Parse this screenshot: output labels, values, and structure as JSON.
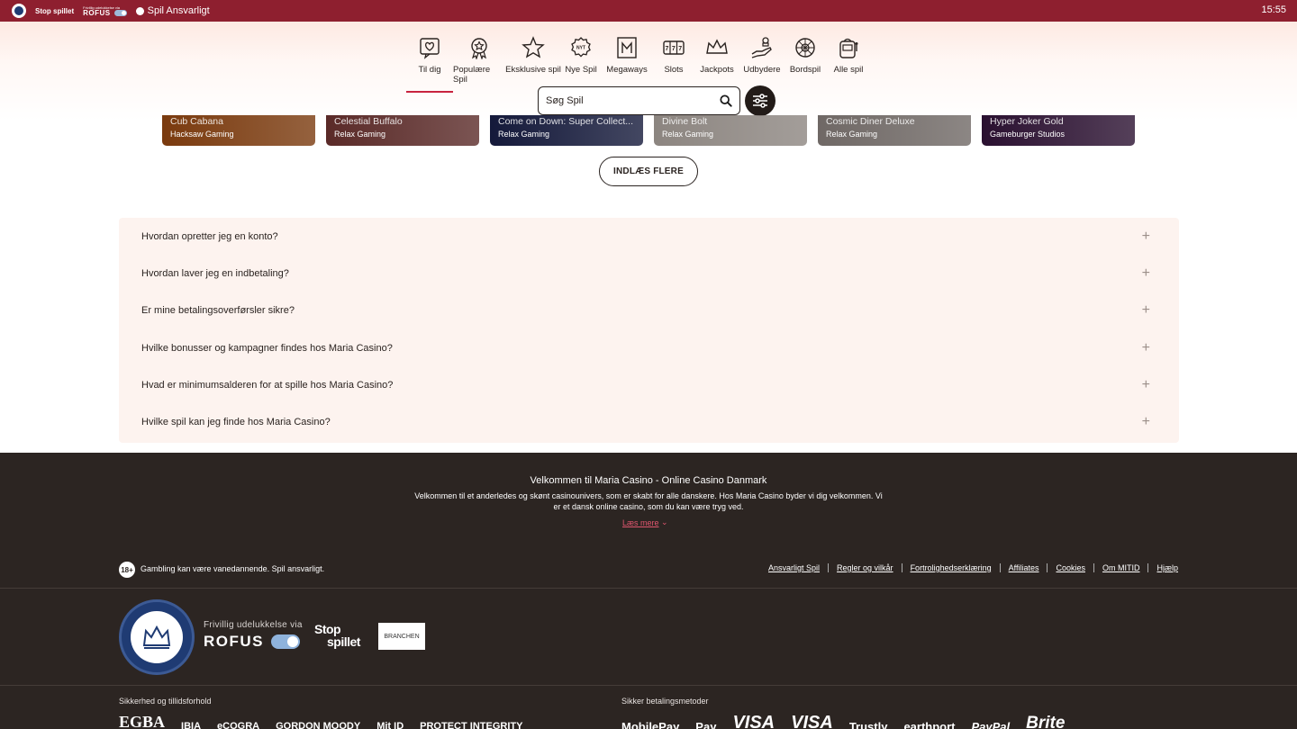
{
  "topbar": {
    "stop_label": "Stop spillet",
    "rofus_small": "Frivillig udelukkelse via",
    "rofus_label": "ROFUS",
    "responsible_label": "Spil Ansvarligt",
    "time": "15:55"
  },
  "categories": [
    {
      "label": "Til dig",
      "icon": "heart-chat-icon",
      "active": true
    },
    {
      "label": "Populære Spil",
      "icon": "award-icon",
      "active": false
    },
    {
      "label": "Eksklusive spil",
      "icon": "star-icon",
      "active": false
    },
    {
      "label": "Nye Spil",
      "icon": "new-badge-icon",
      "active": false
    },
    {
      "label": "Megaways",
      "icon": "megaways-icon",
      "active": false
    },
    {
      "label": "Slots",
      "icon": "slot-reels-icon",
      "active": false
    },
    {
      "label": "Jackpots",
      "icon": "crown-icon",
      "active": false
    },
    {
      "label": "Udbydere",
      "icon": "hand-chips-icon",
      "active": false
    },
    {
      "label": "Bordspil",
      "icon": "roulette-icon",
      "active": false
    },
    {
      "label": "Alle spil",
      "icon": "slot-machine-icon",
      "active": false
    }
  ],
  "search": {
    "placeholder": "Søg Spil"
  },
  "games": [
    {
      "title": "Cub Cabana",
      "provider": "Hacksaw Gaming",
      "color": "#7a3a0e"
    },
    {
      "title": "Celestial Buffalo",
      "provider": "Relax Gaming",
      "color": "#5a2a28"
    },
    {
      "title": "Come on Down: Super Collect...",
      "provider": "Relax Gaming",
      "color": "#14193a"
    },
    {
      "title": "Divine Bolt",
      "provider": "Relax Gaming",
      "color": "#8c8580"
    },
    {
      "title": "Cosmic Diner Deluxe",
      "provider": "Relax Gaming",
      "color": "#6f6865"
    },
    {
      "title": "Hyper Joker Gold",
      "provider": "Gameburger Studios",
      "color": "#2a1030"
    }
  ],
  "load_more": "INDLÆS FLERE",
  "faq": [
    "Hvordan opretter jeg en konto?",
    "Hvordan laver jeg en indbetaling?",
    "Er mine betalingsoverførsler sikre?",
    "Hvilke bonusser og kampagner findes hos Maria Casino?",
    "Hvad er minimumsalderen for at spille hos Maria Casino?",
    "Hvilke spil kan jeg finde hos Maria Casino?"
  ],
  "footer": {
    "title": "Velkommen til Maria Casino - Online Casino Danmark",
    "text": "Velkommen til et anderledes og skønt casinounivers, som er skabt for alle danskere. Hos Maria Casino byder vi dig velkommen. Vi er et dansk online casino, som du kan være tryg ved.",
    "read_more": "Læs mere",
    "age": "18+",
    "warning": "Gambling kan være vanedannende. Spil ansvarligt.",
    "links": [
      "Ansvarligt Spil",
      "Regler og vilkår",
      "Fortrolighedserklæring",
      "Affiliates",
      "Cookies",
      "Om MITID",
      "Hjælp"
    ],
    "rofus_small": "Frivillig udelukkelse via",
    "rofus_big": "ROFUS",
    "stop1": "Stop",
    "stop2": "spillet",
    "spillebranchen": "BRANCHEN",
    "security_heading": "Sikkerhed og tillidsforhold",
    "security_logos": [
      "EGBA",
      "IBIA",
      "eCOGRA",
      "GORDON MOODY",
      "Mit ID",
      "PROTECT INTEGRITY"
    ],
    "payment_heading": "Sikker betalingsmetoder",
    "payment_logos": [
      "MobilePay",
      "Pay",
      "VISA",
      "VISA",
      "Trustly",
      "earthport",
      "PayPal",
      "Brite"
    ]
  }
}
